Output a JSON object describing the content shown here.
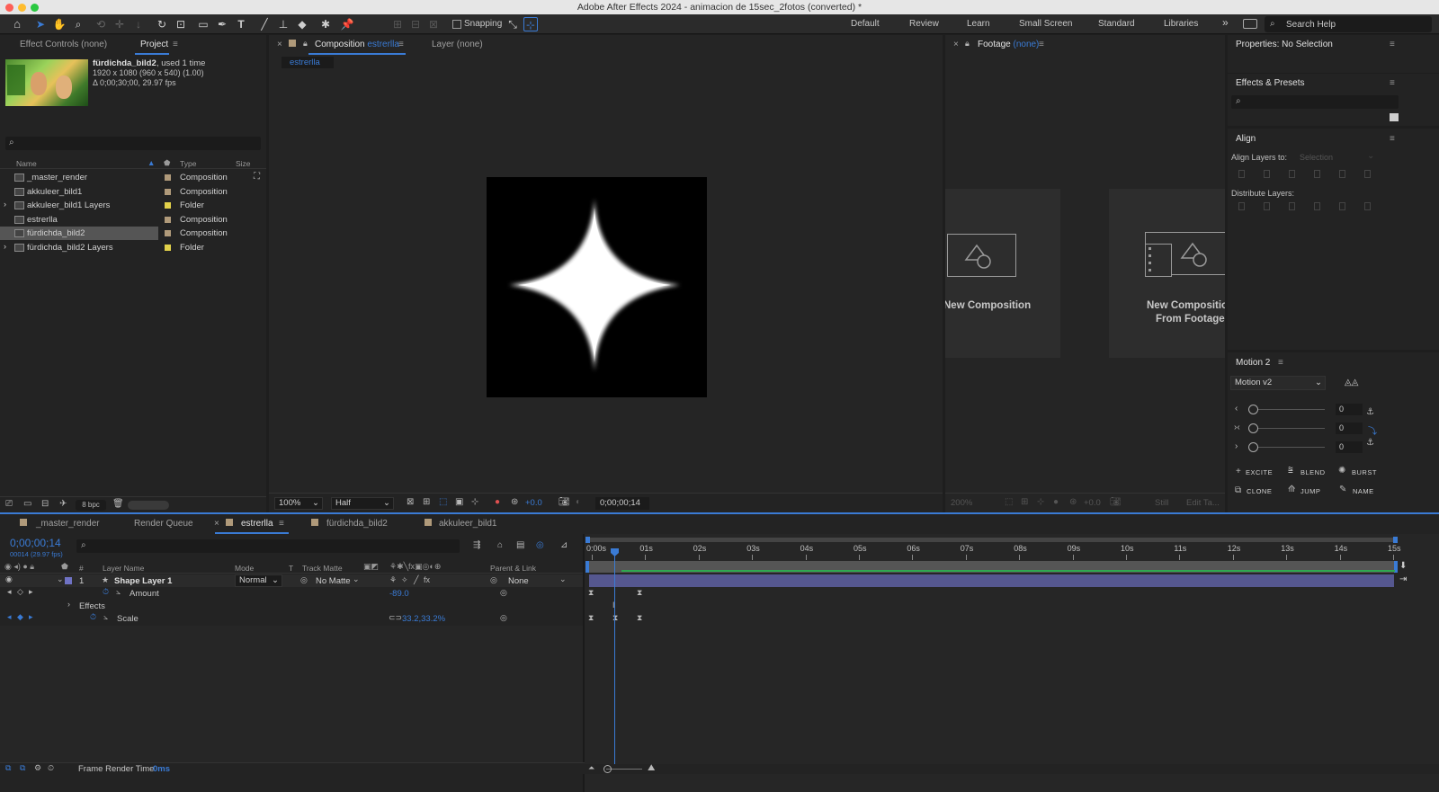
{
  "window": {
    "title": "Adobe After Effects 2024 - animacion de 15sec_2fotos (converted) *"
  },
  "toolbar": {
    "snapping_label": "Snapping",
    "workspaces": [
      "Default",
      "Review",
      "Learn",
      "Small Screen",
      "Standard",
      "Libraries"
    ],
    "more": "»",
    "search_help": "Search Help"
  },
  "left_panel": {
    "tabs": [
      "Effect Controls (none)",
      "Project"
    ],
    "preview": {
      "name": "fürdichda_bild2",
      "used": ", used 1 time",
      "size": "1920 x 1080  (960 x 540) (1.00)",
      "duration": "Δ 0;00;30;00, 29.97 fps"
    },
    "columns": {
      "name": "Name",
      "type": "Type",
      "size": "Size"
    },
    "items": [
      {
        "name": "_master_render",
        "type": "Composition",
        "swatch": "#b09a7a",
        "folder": false,
        "selected": false
      },
      {
        "name": "akkuleer_bild1",
        "type": "Composition",
        "swatch": "#b09a7a",
        "folder": false,
        "selected": false
      },
      {
        "name": "akkuleer_bild1 Layers",
        "type": "Folder",
        "swatch": "#e2d14a",
        "folder": true,
        "selected": false
      },
      {
        "name": "estrerlla",
        "type": "Composition",
        "swatch": "#b09a7a",
        "folder": false,
        "selected": false
      },
      {
        "name": "fürdichda_bild2",
        "type": "Composition",
        "swatch": "#b09a7a",
        "folder": false,
        "selected": true
      },
      {
        "name": "fürdichda_bild2 Layers",
        "type": "Folder",
        "swatch": "#e2d14a",
        "folder": true,
        "selected": false
      }
    ],
    "bpc": "8 bpc"
  },
  "comp_panel": {
    "tab_prefix": "Composition",
    "tab_name": "estrerlla",
    "layer_tab": "Layer (none)",
    "breadcrumb": "estrerlla",
    "zoom": "100%",
    "resolution": "Half",
    "exposure": "+0.0",
    "timecode": "0;00;00;14"
  },
  "footage_panel": {
    "tab_prefix": "Footage",
    "tab_name": "(none)",
    "new_comp": "New Composition",
    "new_comp_footage_1": "New Composition",
    "new_comp_footage_2": "From Footage",
    "zoom": "200%",
    "exposure": "+0.0",
    "still": "Still",
    "edit": "Edit Ta..."
  },
  "right_panel": {
    "properties": "Properties: No Selection",
    "effects_presets": "Effects & Presets",
    "align": "Align",
    "align_to_label": "Align Layers to:",
    "align_to_value": "Selection",
    "distribute": "Distribute Layers:",
    "motion_title": "Motion 2",
    "motion_select": "Motion v2",
    "slider_values": [
      "0",
      "0",
      "0"
    ],
    "buttons": [
      "EXCITE",
      "BLEND",
      "BURST",
      "CLONE",
      "JUMP",
      "NAME"
    ]
  },
  "timeline": {
    "tabs": [
      "_master_render",
      "Render Queue",
      "estrerlla",
      "fürdichda_bild2",
      "akkuleer_bild1"
    ],
    "timecode": "0;00;00;14",
    "frame_info": "00014 (29.97 fps)",
    "columns": {
      "num": "#",
      "layer_name": "Layer Name",
      "mode": "Mode",
      "t": "T",
      "track_matte": "Track Matte",
      "parent": "Parent & Link"
    },
    "layer": {
      "num": "1",
      "name": "Shape Layer 1",
      "mode": "Normal",
      "matte": "No Matte",
      "parent": "None"
    },
    "amount": {
      "label": "Amount",
      "value": "-89.0"
    },
    "effects_label": "Effects",
    "scale": {
      "label": "Scale",
      "value": "33.2,33.2%"
    },
    "ruler": [
      "0:00s",
      "01s",
      "02s",
      "03s",
      "04s",
      "05s",
      "06s",
      "07s",
      "08s",
      "09s",
      "10s",
      "11s",
      "12s",
      "13s",
      "14s",
      "15s"
    ],
    "frame_render_label": "Frame Render Time",
    "frame_render_value": "0ms"
  },
  "colors": {
    "accent": "#3a7bd5",
    "layer_label": "#6f72c4",
    "layer_bar": "#55578f",
    "folder": "#e2d14a",
    "comp": "#b09a7a"
  }
}
